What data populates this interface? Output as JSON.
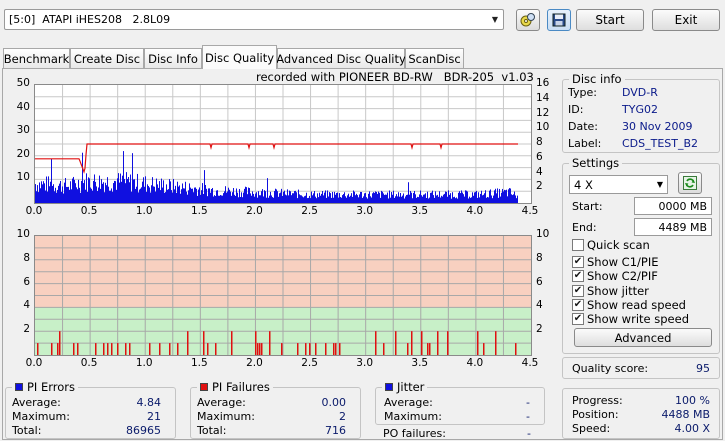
{
  "toolbar": {
    "drive": "[5:0]  ATAPI iHES208   2.8L09",
    "start_label": "Start",
    "exit_label": "Exit"
  },
  "tabs": [
    {
      "label": "Benchmark",
      "active": false
    },
    {
      "label": "Create Disc",
      "active": false
    },
    {
      "label": "Disc Info",
      "active": false
    },
    {
      "label": "Disc Quality",
      "active": true
    },
    {
      "label": "Advanced Disc Quality",
      "active": false
    },
    {
      "label": "ScanDisc",
      "active": false
    }
  ],
  "recorded_with": "recorded with PIONEER BD-RW   BDR-205  v1.03",
  "upper_chart": {
    "type": "bar",
    "x_ticks": [
      "0.0",
      "0.5",
      "1.0",
      "1.5",
      "2.0",
      "2.5",
      "3.0",
      "3.5",
      "4.0",
      "4.5"
    ],
    "y_left_ticks": [
      "10",
      "20",
      "30",
      "40",
      "50"
    ],
    "y_right_ticks": [
      "2",
      "4",
      "6",
      "8",
      "10",
      "12",
      "14",
      "16"
    ],
    "xlim": [
      0,
      4.5
    ],
    "ylim": [
      0,
      50
    ],
    "y2lim": [
      0,
      16
    ],
    "pie_series_color": "#1010e0",
    "speed_series_color": "#e01010",
    "pie_profile": [
      [
        0,
        9
      ],
      [
        0.3,
        8
      ],
      [
        0.45,
        10
      ],
      [
        0.8,
        10
      ],
      [
        1.2,
        8
      ],
      [
        1.6,
        6
      ],
      [
        2.0,
        5
      ],
      [
        2.5,
        4
      ],
      [
        3.0,
        4
      ],
      [
        3.5,
        4
      ],
      [
        4.0,
        4
      ],
      [
        4.3,
        5
      ],
      [
        4.38,
        3
      ]
    ],
    "speed_profile": [
      [
        0,
        6.0
      ],
      [
        0.4,
        6.0
      ],
      [
        0.45,
        4.0
      ],
      [
        0.47,
        8.0
      ],
      [
        4.38,
        8.0
      ]
    ]
  },
  "lower_chart": {
    "type": "bar",
    "x_ticks": [
      "0.0",
      "0.5",
      "1.0",
      "1.5",
      "2.0",
      "2.5",
      "3.0",
      "3.5",
      "4.0",
      "4.5"
    ],
    "y_ticks": [
      "2",
      "4",
      "6",
      "8",
      "10"
    ],
    "xlim": [
      0,
      4.5
    ],
    "ylim": [
      0,
      10
    ],
    "bands": [
      {
        "from": 0,
        "to": 4,
        "color": "#c8f0c8"
      },
      {
        "from": 4,
        "to": 10,
        "color": "#f8d0c0"
      }
    ],
    "pif_color": "#e01010",
    "pif_max": 2
  },
  "pi_errors": {
    "title": "PI Errors",
    "color": "#1010e0",
    "average_label": "Average:",
    "average": "4.84",
    "maximum_label": "Maximum:",
    "maximum": "21",
    "total_label": "Total:",
    "total": "86965"
  },
  "pi_failures": {
    "title": "PI Failures",
    "color": "#e01010",
    "average_label": "Average:",
    "average": "0.00",
    "maximum_label": "Maximum:",
    "maximum": "2",
    "total_label": "Total:",
    "total": "716"
  },
  "jitter": {
    "title": "Jitter",
    "color": "#1010e0",
    "average_label": "Average:",
    "average": "-",
    "maximum_label": "Maximum:",
    "maximum": "-",
    "po_label": "PO failures:",
    "po": "-"
  },
  "disc_info": {
    "title": "Disc info",
    "type_label": "Type:",
    "type": "DVD-R",
    "id_label": "ID:",
    "id": "TYG02",
    "date_label": "Date:",
    "date": "30 Nov 2009",
    "label_label": "Label:",
    "label": "CDS_TEST_B2"
  },
  "settings": {
    "title": "Settings",
    "speed": "4 X",
    "start_label": "Start:",
    "start": "0000 MB",
    "end_label": "End:",
    "end": "4489 MB",
    "quick_scan": "Quick scan",
    "show_c1": "Show C1/PIE",
    "show_c2": "Show C2/PIF",
    "show_jitter": "Show jitter",
    "show_read": "Show read speed",
    "show_write": "Show write speed",
    "advanced_label": "Advanced"
  },
  "quality": {
    "label": "Quality score:",
    "score": "95"
  },
  "progress": {
    "progress_label": "Progress:",
    "progress": "100 %",
    "position_label": "Position:",
    "position": "4488 MB",
    "speed_label": "Speed:",
    "speed": "4.00 X"
  }
}
